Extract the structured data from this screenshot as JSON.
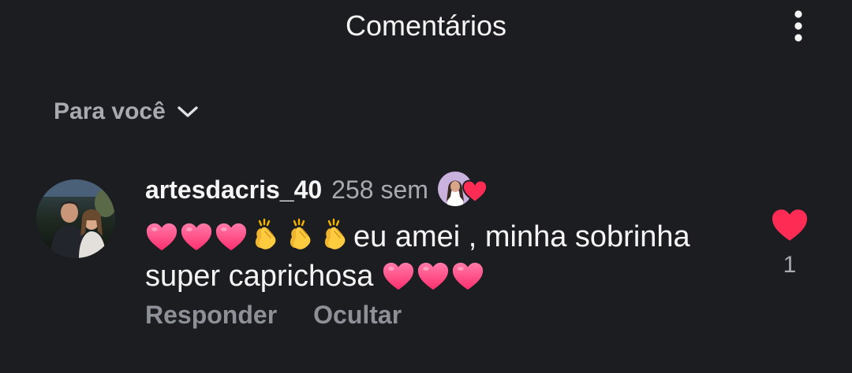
{
  "header": {
    "title": "Comentários",
    "menu_icon": "more-vertical-icon"
  },
  "filter": {
    "label": "Para você",
    "icon": "chevron-down-icon"
  },
  "comment": {
    "username": "artesdacris_40",
    "timestamp": "258 sem",
    "creator_liked": true,
    "text_line1": "eu amei , minha sobrinha",
    "text_line2": "super caprichosa",
    "leading_emoji": [
      "pink-heart",
      "pink-heart",
      "pink-heart",
      "clapping-hands",
      "clapping-hands",
      "clapping-hands"
    ],
    "trailing_emoji": [
      "pink-heart",
      "pink-heart",
      "pink-heart"
    ],
    "actions": {
      "reply": "Responder",
      "hide": "Ocultar"
    },
    "like": {
      "liked": true,
      "count": "1",
      "color": "#fe2c55"
    }
  },
  "colors": {
    "background": "#1c1d21",
    "primary_text": "#f5f5f5",
    "secondary_text": "#a8aab0",
    "like_red": "#fe2c55",
    "emoji_heart_pink": "#ff3d7f"
  }
}
